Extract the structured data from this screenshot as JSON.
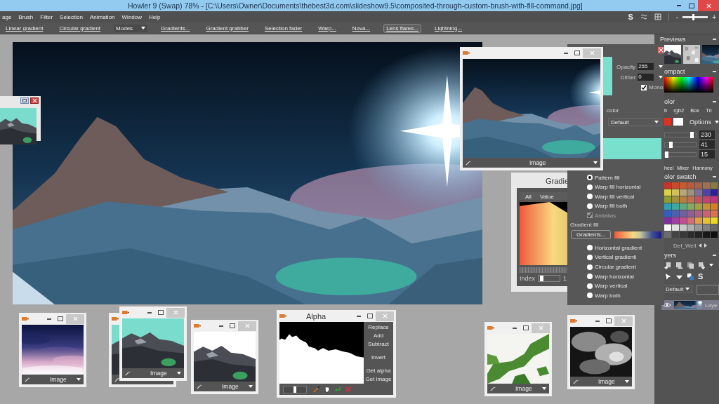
{
  "window": {
    "title": "Howler 9  (Swap)   78%   - [C:\\Users\\Owner\\Documents\\thebest3d.com\\slideshow9.5\\composited-through-custom-brush-with-fill-command.jpg]"
  },
  "menu": [
    "age",
    "Brush",
    "Filter",
    "Selection",
    "Animation",
    "Window",
    "Help"
  ],
  "menu_tools": {
    "glyph": "S",
    "minus": "-",
    "plus": "+",
    "level": 0.4
  },
  "toolbar": [
    {
      "label": "Linear gradient",
      "kind": "link",
      "selected": false
    },
    {
      "label": "Circular gradient",
      "kind": "link",
      "selected": false
    },
    {
      "label": "Modes",
      "kind": "dropdown",
      "selected": false
    },
    {
      "label": "Gradients...",
      "kind": "link",
      "selected": false
    },
    {
      "label": "Gradient grabber",
      "kind": "link",
      "selected": false
    },
    {
      "label": "Selection fader",
      "kind": "link",
      "selected": false
    },
    {
      "label": "Warp...",
      "kind": "link",
      "selected": false
    },
    {
      "label": "Nova...",
      "kind": "link",
      "selected": false
    },
    {
      "label": "Lens flares...",
      "kind": "link",
      "selected": true
    },
    {
      "label": "Lightning...",
      "kind": "link",
      "selected": false
    }
  ],
  "preview_window": {
    "footer": "Image"
  },
  "image_windows": [
    {
      "footer": "Image"
    },
    {
      "footer": "Image"
    },
    {
      "footer": "Image"
    },
    {
      "footer": "Image"
    },
    {
      "footer": "Image"
    }
  ],
  "alpha_window": {
    "title": "Alpha",
    "actions": [
      "Replace",
      "Add",
      "Subtract",
      "Invert",
      "Get alpha",
      "Get image"
    ],
    "level": 0.5
  },
  "gradient_window": {
    "title": "Gradie",
    "tabs": [
      "All",
      "Value"
    ],
    "index_label": "Index",
    "index_value": "1",
    "level": 0.05
  },
  "fill_panel": {
    "opacity_label": "Opacity",
    "opacity": "255",
    "dither_label": "Dither",
    "dither": "0",
    "mono": {
      "label": "Mono",
      "checked": true
    },
    "color_label": "color",
    "style": "Default",
    "fills": [
      {
        "label": "Pattern fill",
        "selected": true
      },
      {
        "label": "Warp fill horizontal",
        "selected": false
      },
      {
        "label": "Warp fill vertical",
        "selected": false
      },
      {
        "label": "Warp fill both",
        "selected": false
      }
    ],
    "antialias": {
      "label": "Antialias",
      "checked": true,
      "disabled": true
    },
    "gradient_heading": "Gradient fill",
    "gradients_button": "Gradients...",
    "gradient_modes": [
      {
        "label": "Horizontal gradient",
        "selected": false
      },
      {
        "label": "Vertical gradientl",
        "selected": false
      },
      {
        "label": "Circular gradient",
        "selected": false
      },
      {
        "label": "Warp horizontal",
        "selected": false
      },
      {
        "label": "Warp vertical",
        "selected": false
      },
      {
        "label": "Warp both",
        "selected": false
      }
    ]
  },
  "right_panel": {
    "previews": "Previews",
    "compact": "ompact",
    "color_heading": "olor",
    "color_tabs": [
      "b",
      "rgb2",
      "Box",
      "Tri"
    ],
    "options": "Options",
    "channels": [
      {
        "value": "230",
        "level": 0.88
      },
      {
        "value": "41",
        "level": 0.2
      },
      {
        "value": "15",
        "level": 0.06
      }
    ],
    "mixer_tabs": [
      "heel",
      "Mixer",
      "Harmony"
    ],
    "swatch_heading": "olor swatch",
    "swatches": [
      {
        "color": "#c8342a"
      },
      {
        "color": "#c84a2c"
      },
      {
        "color": "#c85a30"
      },
      {
        "color": "#b85a40"
      },
      {
        "color": "#a86048"
      },
      {
        "color": "#a07050"
      },
      {
        "color": "#8a7a40"
      },
      {
        "color": "#e0d040"
      },
      {
        "color": "#d0c060"
      },
      {
        "color": "#b8a878"
      },
      {
        "color": "#a09080"
      },
      {
        "color": "#806ca0"
      },
      {
        "color": "#5040b0"
      },
      {
        "color": "#2820a0"
      },
      {
        "color": "#8aa030"
      },
      {
        "color": "#a09040"
      },
      {
        "color": "#b88040"
      },
      {
        "color": "#c07050"
      },
      {
        "color": "#c85060"
      },
      {
        "color": "#c84070"
      },
      {
        "color": "#c83080"
      },
      {
        "color": "#30a0b0"
      },
      {
        "color": "#40a8a0"
      },
      {
        "color": "#60a880"
      },
      {
        "color": "#88a860"
      },
      {
        "color": "#a8a040"
      },
      {
        "color": "#c89030"
      },
      {
        "color": "#d88020"
      },
      {
        "color": "#3060c0"
      },
      {
        "color": "#5060b0"
      },
      {
        "color": "#7060a0"
      },
      {
        "color": "#906090"
      },
      {
        "color": "#b06080"
      },
      {
        "color": "#d06070"
      },
      {
        "color": "#e07050"
      },
      {
        "color": "#8030a0"
      },
      {
        "color": "#a040a0"
      },
      {
        "color": "#c05090"
      },
      {
        "color": "#d07070"
      },
      {
        "color": "#e0a040"
      },
      {
        "color": "#e8c030"
      },
      {
        "color": "#f0d820"
      },
      {
        "color": "#f8f8f8"
      },
      {
        "color": "#e0e0e0"
      },
      {
        "color": "#c8c8c8"
      },
      {
        "color": "#b0b0b0"
      },
      {
        "color": "#989898"
      },
      {
        "color": "#808080"
      },
      {
        "color": "#686868"
      },
      {
        "color": "#6c6c6c"
      },
      {
        "color": "#444444"
      },
      {
        "color": "#383838"
      },
      {
        "color": "#2c2c2c"
      },
      {
        "color": "#222222"
      },
      {
        "color": "#181818"
      },
      {
        "color": "#101010"
      }
    ],
    "well": "Def_Well",
    "layers": "yers",
    "layer_glyph": "S",
    "blend": "Default",
    "layer_name": "Laye"
  }
}
